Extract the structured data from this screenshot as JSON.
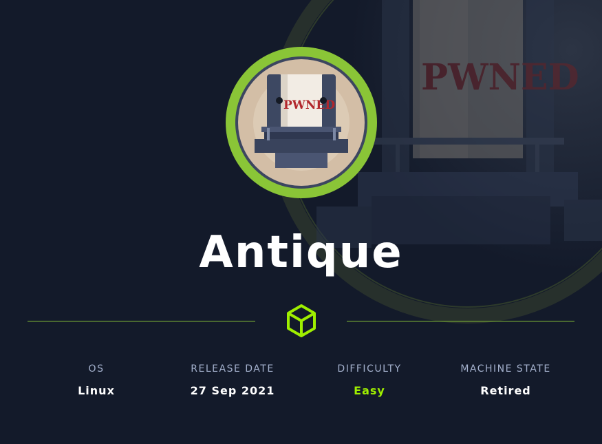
{
  "machine": {
    "name": "Antique",
    "avatar_text": "PWNED"
  },
  "stats": [
    {
      "label": "OS",
      "value": "Linux"
    },
    {
      "label": "RELEASE DATE",
      "value": "27 Sep 2021"
    },
    {
      "label": "DIFFICULTY",
      "value": "Easy"
    },
    {
      "label": "MACHINE STATE",
      "value": "Retired"
    }
  ],
  "colors": {
    "background": "#131a2a",
    "accent_green": "#9fef00",
    "ring_green": "#8ac537",
    "label_gray": "#a4b1cd",
    "text_white": "#ffffff"
  },
  "icons": {
    "divider_icon": "cube-icon"
  }
}
